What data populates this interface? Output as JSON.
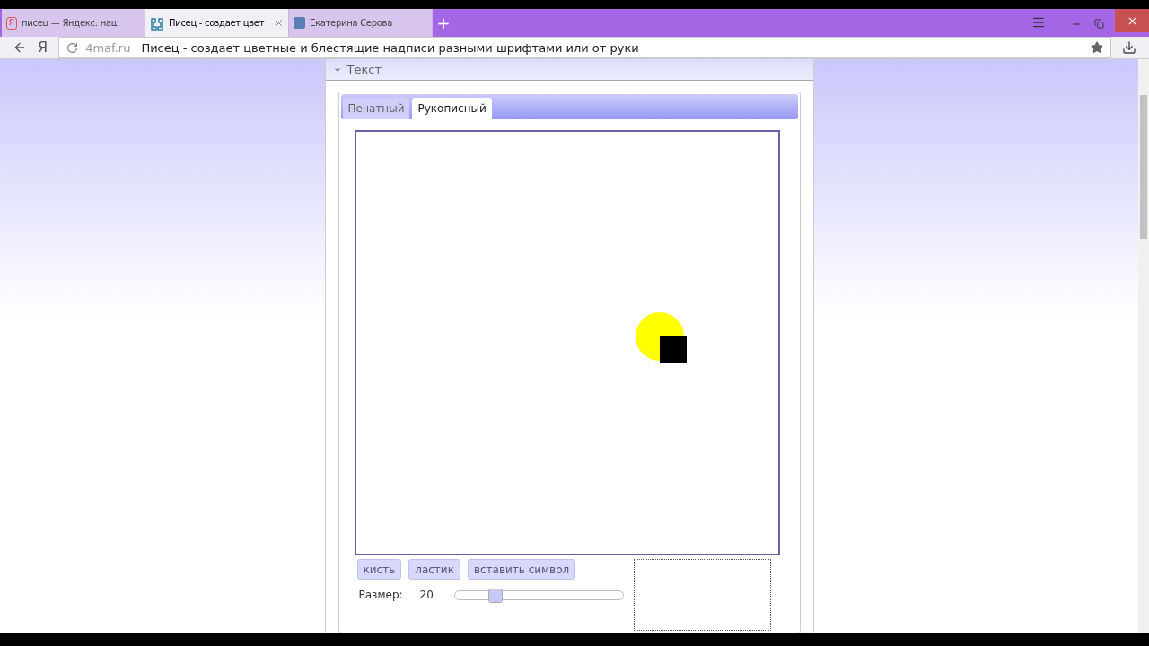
{
  "browser": {
    "tabs": [
      {
        "title": "писец — Яндекс: наш",
        "selected": false,
        "kind": "yandex"
      },
      {
        "title": "Писец - создает цвет",
        "selected": true,
        "kind": "site"
      },
      {
        "title": "Екатерина Серова",
        "selected": false,
        "kind": "vk"
      }
    ],
    "new_tab": "+",
    "favicon_letter": "Я",
    "home": "Я",
    "address": {
      "domain": "4maf.ru",
      "title": "Писец - создает цветные и блестящие надписи разными шрифтами или от руки"
    }
  },
  "panel": {
    "title": "Текст",
    "expanded": true,
    "tabs": [
      {
        "label": "Печатный",
        "selected": false
      },
      {
        "label": "Рукописный",
        "selected": true
      }
    ],
    "tools": [
      "кисть",
      "ластик",
      "вставить символ"
    ],
    "size": {
      "label": "Размер:",
      "value": "20",
      "level": 0.2
    }
  }
}
